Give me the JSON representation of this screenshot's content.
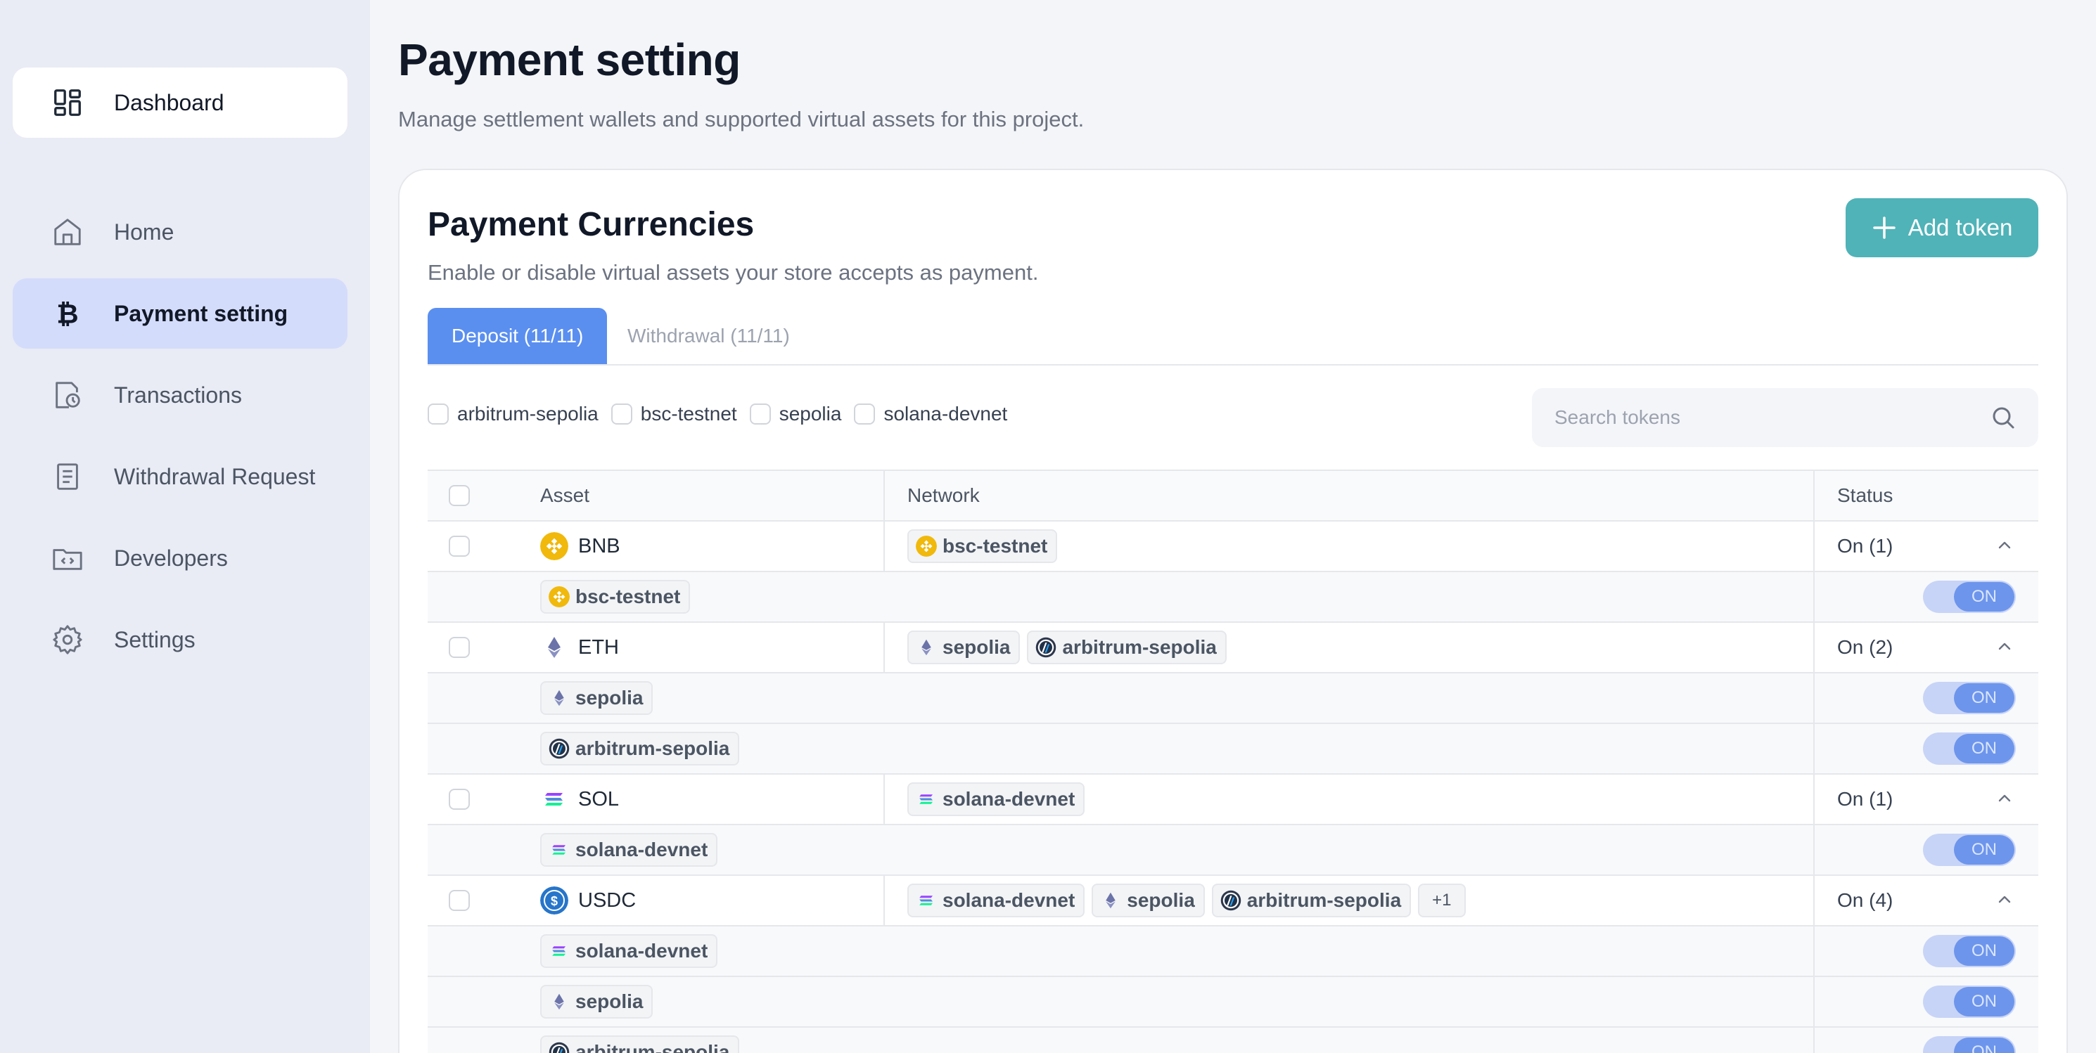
{
  "sidebar": {
    "dashboard_label": "Dashboard",
    "items": [
      {
        "label": "Home",
        "icon": "home-icon"
      },
      {
        "label": "Payment setting",
        "icon": "bitcoin-icon",
        "active": true
      },
      {
        "label": "Transactions",
        "icon": "transactions-icon"
      },
      {
        "label": "Withdrawal Request",
        "icon": "receipt-icon"
      },
      {
        "label": "Developers",
        "icon": "code-folder-icon"
      },
      {
        "label": "Settings",
        "icon": "gear-icon"
      }
    ]
  },
  "page": {
    "title": "Payment setting",
    "subtitle": "Manage settlement wallets and supported virtual assets for this project."
  },
  "card": {
    "title": "Payment Currencies",
    "subtitle": "Enable or disable virtual assets your store accepts as payment.",
    "add_button": "Add token",
    "tabs": [
      {
        "label": "Deposit (11/11)",
        "active": true
      },
      {
        "label": "Withdrawal (11/11)",
        "active": false
      }
    ],
    "filters": [
      "arbitrum-sepolia",
      "bsc-testnet",
      "sepolia",
      "solana-devnet"
    ],
    "search_placeholder": "Search tokens"
  },
  "table": {
    "headers": {
      "asset": "Asset",
      "network": "Network",
      "status": "Status"
    },
    "toggle_label": "ON",
    "more_chip": "+1",
    "assets": [
      {
        "name": "BNB",
        "status": "On (1)",
        "networks": [
          "bsc-testnet"
        ]
      },
      {
        "name": "ETH",
        "status": "On (2)",
        "networks": [
          "sepolia",
          "arbitrum-sepolia"
        ]
      },
      {
        "name": "SOL",
        "status": "On (1)",
        "networks": [
          "solana-devnet"
        ]
      },
      {
        "name": "USDC",
        "status": "On (4)",
        "networks": [
          "solana-devnet",
          "sepolia",
          "arbitrum-sepolia"
        ],
        "sub_networks": [
          "solana-devnet",
          "sepolia",
          "arbitrum-sepolia"
        ]
      }
    ]
  },
  "colors": {
    "accent": "#5a8ff0",
    "add_button": "#4fb3b8",
    "sidebar_bg": "#e9ebf5",
    "active_nav": "#d4dcfb",
    "bnb": "#f0b90b",
    "eth": "#627eea",
    "usdc": "#2775ca"
  }
}
